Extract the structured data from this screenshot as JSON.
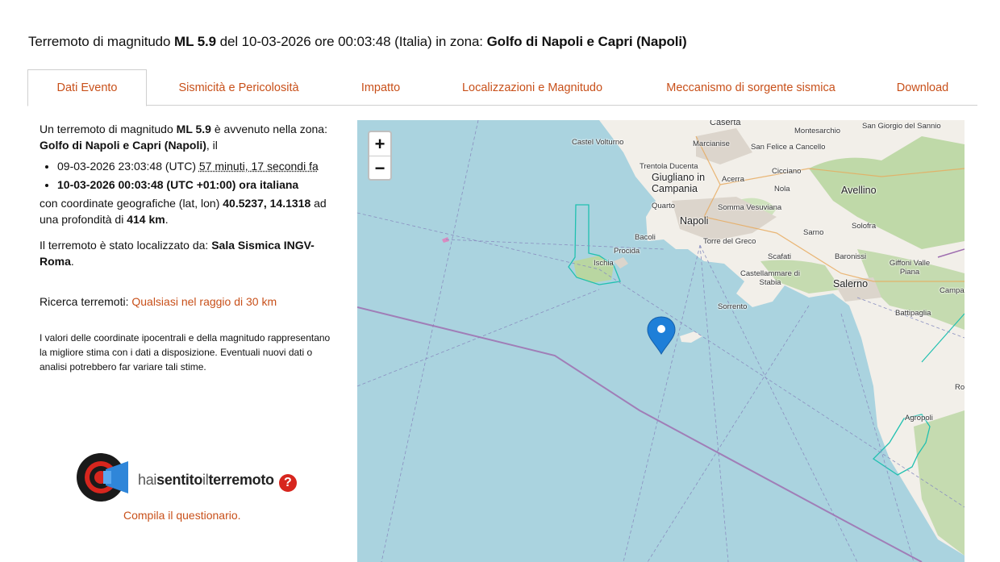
{
  "title": {
    "prefix": "Terremoto di magnitudo",
    "magnitude": "ML 5.9",
    "middle": "del 10-03-2026 ore 00:03:48 (Italia) in zona:",
    "zone": "Golfo di Napoli e Capri (Napoli)"
  },
  "tabs": [
    {
      "label": "Dati Evento",
      "active": true
    },
    {
      "label": "Sismicità e Pericolosità"
    },
    {
      "label": "Impatto"
    },
    {
      "label": "Localizzazioni e Magnitudo"
    },
    {
      "label": "Meccanismo di sorgente sismica"
    },
    {
      "label": "Download"
    }
  ],
  "event": {
    "intro_1": "Un terremoto di magnitudo",
    "magnitude": "ML 5.9",
    "intro_2": "è avvenuto nella zona:",
    "zone": "Golfo di Napoli e Capri (Napoli)",
    "intro_3": ", il",
    "utc_time": "09-03-2026 23:03:48 (UTC)",
    "relative": "57 minuti, 17 secondi fa",
    "local_time": "10-03-2026 00:03:48 (UTC +01:00) ora italiana",
    "coord_1": "con coordinate geografiche (lat, lon)",
    "coords": "40.5237, 14.1318",
    "coord_2": "ad una profondità di",
    "depth": "414 km",
    "loc_by": "Il terremoto è stato localizzato da:",
    "loc_agency": "Sala Sismica INGV-Roma",
    "search_label": "Ricerca terremoti:",
    "search_link": "Qualsiasi nel raggio di 30 km",
    "note": "I valori delle coordinate ipocentrali e della magnitudo rappresentano la migliore stima con i dati a disposizione. Eventuali nuovi dati o analisi potrebbero far variare tali stime."
  },
  "hst": {
    "thin_1": "hai",
    "bold_1": "sentito",
    "thin_2": "il",
    "bold_2": "terremoto",
    "help_glyph": "?",
    "questionnaire": "Compila il questionario."
  },
  "map": {
    "zoom_in": "+",
    "zoom_out": "−",
    "colors": {
      "sea": "#aad3df",
      "land": "#f2efe9",
      "forest": "#b9d6a1",
      "urban": "#dcd5cc",
      "border": "#9f6eb0",
      "fault": "#20c0b0",
      "marker": "#1e7fd8"
    },
    "places": [
      {
        "name": "Caserta"
      },
      {
        "name": "Montesarchio"
      },
      {
        "name": "San Giorgio del Sannio"
      },
      {
        "name": "Castel Volturno"
      },
      {
        "name": "Marcianise"
      },
      {
        "name": "San Felice a Cancello"
      },
      {
        "name": "Trentola Ducenta"
      },
      {
        "name": "Giugliano in Campania"
      },
      {
        "name": "Acerra"
      },
      {
        "name": "Cicciano"
      },
      {
        "name": "Nola"
      },
      {
        "name": "Avellino"
      },
      {
        "name": "Quarto"
      },
      {
        "name": "Somma Vesuviana"
      },
      {
        "name": "Napoli"
      },
      {
        "name": "Solofra"
      },
      {
        "name": "Bacoli"
      },
      {
        "name": "Torre del Greco"
      },
      {
        "name": "Sarno"
      },
      {
        "name": "Procida"
      },
      {
        "name": "Ischia"
      },
      {
        "name": "Scafati"
      },
      {
        "name": "Baronissi"
      },
      {
        "name": "Giffoni Valle Piana"
      },
      {
        "name": "Castellammare di Stabia"
      },
      {
        "name": "Salerno"
      },
      {
        "name": "Campa"
      },
      {
        "name": "Sorrento"
      },
      {
        "name": "Battipaglia"
      },
      {
        "name": "Agropoli"
      },
      {
        "name": "Ro"
      }
    ]
  }
}
